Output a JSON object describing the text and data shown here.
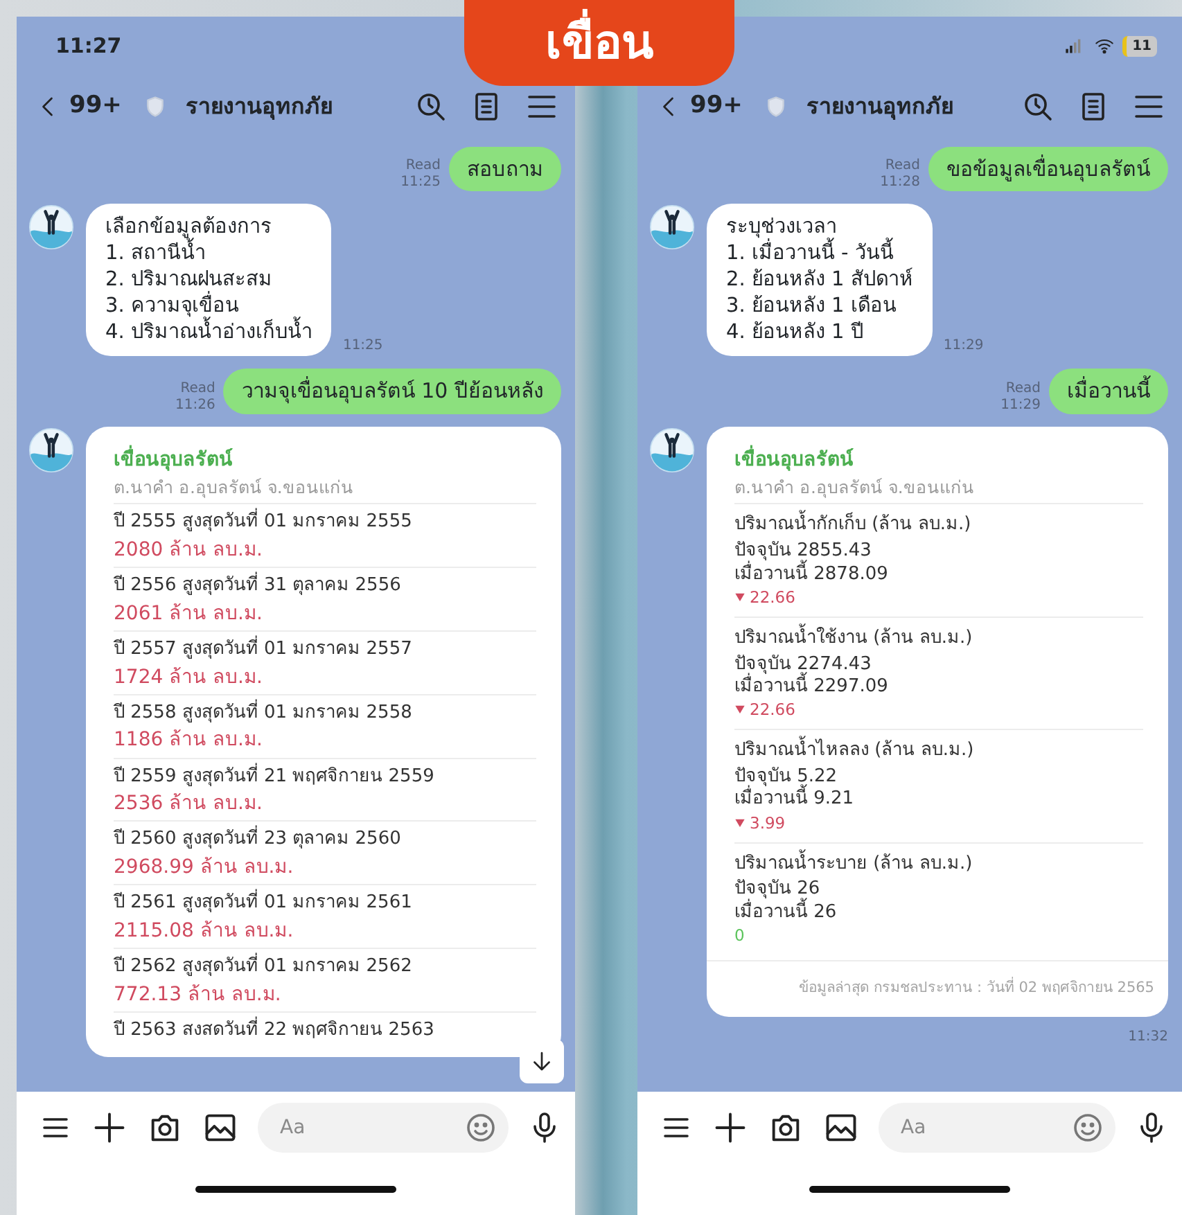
{
  "title": "เขื่อน",
  "phones": [
    {
      "status": {
        "time": "11:27"
      },
      "header": {
        "back_count": "99+",
        "chat_name": "รายงานอุทกภัย"
      },
      "messages": [
        {
          "kind": "sent",
          "text": "สอบถาม",
          "read": "Read",
          "time": "11:25"
        },
        {
          "kind": "received",
          "lines": [
            "เลือกข้อมูลต้องการ",
            "1. สถานีน้ำ",
            "2. ปริมาณฝนสะสม",
            "3. ความจุเขื่อน",
            "4. ปริมาณน้ำอ่างเก็บน้ำ"
          ],
          "time": "11:25"
        },
        {
          "kind": "sent",
          "text": "วามจุเขื่อนอุบลรัตน์ 10 ปีย้อนหลัง",
          "read": "Read",
          "time": "11:26"
        },
        {
          "kind": "card_yearly",
          "title": "เขื่อนอุบลรัตน์",
          "subtitle": "ต.นาคำ อ.อุบลรัตน์ จ.ขอนแก่น",
          "rows": [
            {
              "label": "ปี 2555 สูงสุดวันที่ 01 มกราคม 2555",
              "value": "2080 ล้าน ลบ.ม."
            },
            {
              "label": "ปี 2556 สูงสุดวันที่ 31 ตุลาคม 2556",
              "value": "2061 ล้าน ลบ.ม."
            },
            {
              "label": "ปี 2557 สูงสุดวันที่ 01 มกราคม 2557",
              "value": "1724 ล้าน ลบ.ม."
            },
            {
              "label": "ปี 2558 สูงสุดวันที่ 01 มกราคม 2558",
              "value": "1186 ล้าน ลบ.ม."
            },
            {
              "label": "ปี 2559 สูงสุดวันที่ 21 พฤศจิกายน 2559",
              "value": "2536 ล้าน ลบ.ม."
            },
            {
              "label": "ปี 2560 สูงสุดวันที่ 23 ตุลาคม 2560",
              "value": "2968.99 ล้าน ลบ.ม."
            },
            {
              "label": "ปี 2561 สูงสุดวันที่ 01 มกราคม 2561",
              "value": "2115.08 ล้าน ลบ.ม."
            },
            {
              "label": "ปี 2562 สูงสุดวันที่ 01 มกราคม 2562",
              "value": "772.13 ล้าน ลบ.ม."
            },
            {
              "label": "ปี 2563 สงสดวันที่ 22 พฤศจิกายน 2563"
            }
          ]
        }
      ],
      "scroll_button": true,
      "composer": {
        "placeholder": "Aa"
      }
    },
    {
      "status": {
        "battery": "11"
      },
      "header": {
        "back_count": "99+",
        "chat_name": "รายงานอุทกภัย"
      },
      "messages": [
        {
          "kind": "sent",
          "text": "ขอข้อมูลเขื่อนอุบลรัตน์",
          "read": "Read",
          "time": "11:28"
        },
        {
          "kind": "received",
          "lines": [
            "ระบุช่วงเวลา",
            "1. เมื่อวานนี้ - วันนี้",
            "2. ย้อนหลัง 1 สัปดาห์",
            "3. ย้อนหลัง 1 เดือน",
            "4. ย้อนหลัง 1 ปี"
          ],
          "time": "11:29"
        },
        {
          "kind": "sent",
          "text": "เมื่อวานนี้",
          "read": "Read",
          "time": "11:29"
        },
        {
          "kind": "card_metrics",
          "title": "เขื่อนอุบลรัตน์",
          "subtitle": "ต.นาคำ อ.อุบลรัตน์ จ.ขอนแก่น",
          "sections": [
            {
              "label": "ปริมาณน้ำกักเก็บ (ล้าน ลบ.ม.)",
              "current": "ปัจจุบัน 2855.43",
              "yesterday": "เมื่อวานนี้ 2878.09",
              "change": "22.66",
              "decreased": true
            },
            {
              "label": "ปริมาณน้ำใช้งาน (ล้าน ลบ.ม.)",
              "current": "ปัจจุบัน 2274.43",
              "yesterday": "เมื่อวานนี้ 2297.09",
              "change": "22.66",
              "decreased": true
            },
            {
              "label": "ปริมาณน้ำไหลลง (ล้าน ลบ.ม.)",
              "current": "ปัจจุบัน 5.22",
              "yesterday": "เมื่อวานนี้ 9.21",
              "change": "3.99",
              "decreased": true
            },
            {
              "label": "ปริมาณน้ำระบาย (ล้าน ลบ.ม.)",
              "current": "ปัจจุบัน 26",
              "yesterday": "เมื่อวานนี้ 26",
              "change": "0",
              "decreased": false
            }
          ],
          "footer": "ข้อมูลล่าสุด กรมชลประทาน : วันที่ 02 พฤศจิกายน 2565",
          "time": "11:32"
        }
      ],
      "composer": {
        "placeholder": "Aa"
      }
    }
  ]
}
